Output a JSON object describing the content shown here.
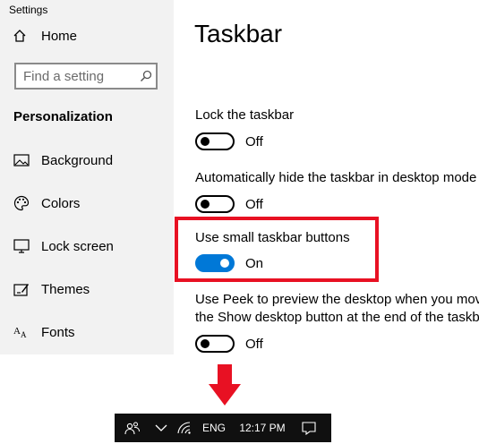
{
  "app": {
    "title": "Settings"
  },
  "sidebar": {
    "home_label": "Home",
    "search_placeholder": "Find a setting",
    "section_title": "Personalization",
    "items": [
      {
        "label": "Background",
        "icon": "image-icon"
      },
      {
        "label": "Colors",
        "icon": "palette-icon"
      },
      {
        "label": "Lock screen",
        "icon": "monitor-icon"
      },
      {
        "label": "Themes",
        "icon": "brush-icon"
      },
      {
        "label": "Fonts",
        "icon": "font-icon"
      }
    ]
  },
  "main": {
    "title": "Taskbar",
    "settings": [
      {
        "label": "Lock the taskbar",
        "state": "Off",
        "on": false
      },
      {
        "label": "Automatically hide the taskbar in desktop mode",
        "state": "Off",
        "on": false
      },
      {
        "label": "Use small taskbar buttons",
        "state": "On",
        "on": true,
        "highlighted": true
      },
      {
        "label_lines": [
          "Use Peek to preview the desktop when you mov",
          "the Show desktop button at the end of the taskb"
        ],
        "state": "Off",
        "on": false
      }
    ]
  },
  "taskbar": {
    "language": "ENG",
    "time": "12:17 PM",
    "icons": [
      "people-icon",
      "chevron-up-icon",
      "wifi-icon",
      "action-center-icon"
    ]
  },
  "colors": {
    "accent": "#0078d7",
    "highlight": "#e81123",
    "arrow": "#e81123",
    "sidebar_bg": "#f2f2f2",
    "taskbar_bg": "#101010"
  }
}
